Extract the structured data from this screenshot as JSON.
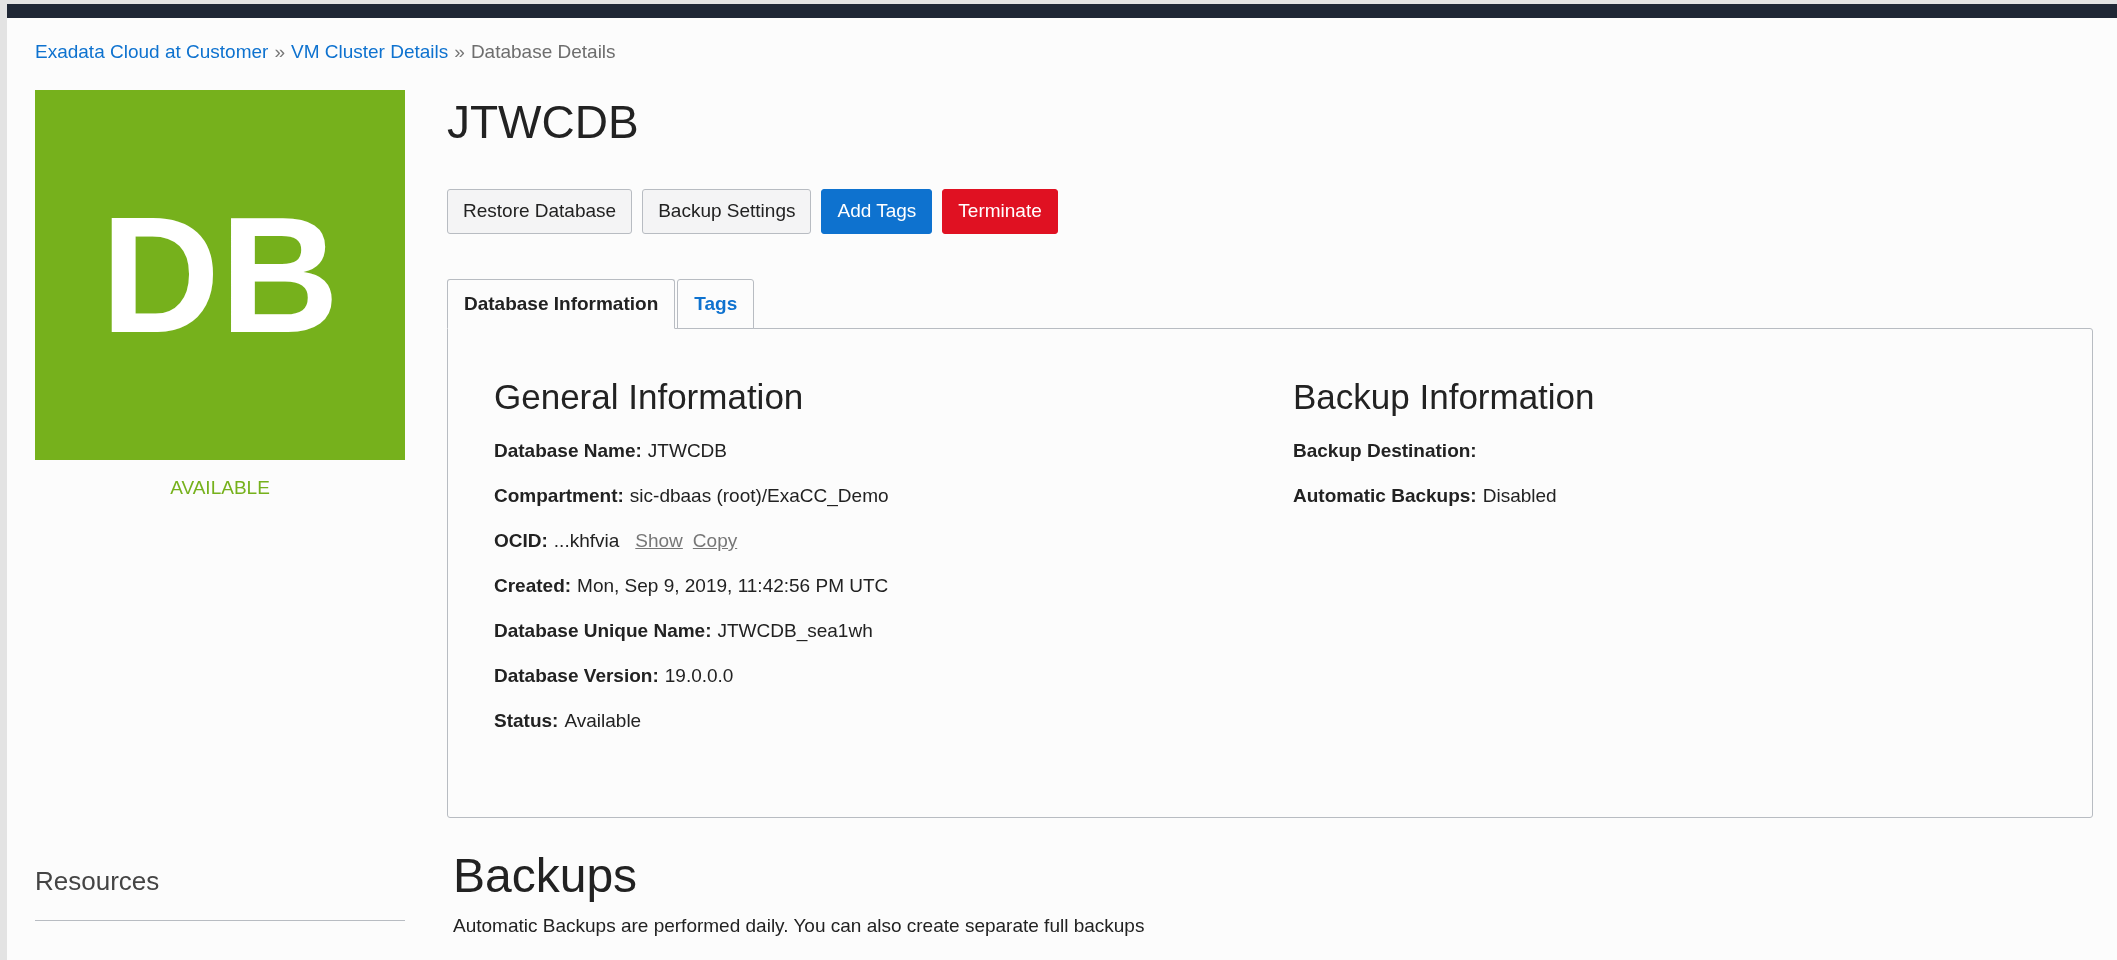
{
  "breadcrumb": [
    {
      "label": "Exadata Cloud at Customer",
      "kind": "link"
    },
    {
      "label": "»",
      "kind": "separator"
    },
    {
      "label": "VM Cluster Details",
      "kind": "link"
    },
    {
      "label": "»",
      "kind": "separator"
    },
    {
      "label": "Database Details",
      "kind": "current"
    }
  ],
  "tile": {
    "initials": "DB",
    "color": "#76b11c",
    "status": "AVAILABLE"
  },
  "title": "JTWCDB",
  "actions": [
    {
      "label": "Restore Database",
      "kind": "default"
    },
    {
      "label": "Backup Settings",
      "kind": "default"
    },
    {
      "label": "Add Tags",
      "kind": "primary"
    },
    {
      "label": "Terminate",
      "kind": "danger"
    }
  ],
  "tabs": [
    {
      "label": "Database Information",
      "selected": true
    },
    {
      "label": "Tags",
      "selected": false
    }
  ],
  "general": {
    "heading": "General Information",
    "fields": [
      {
        "label": "Database Name:",
        "value": "JTWCDB"
      },
      {
        "label": "Compartment:",
        "value": "sic-dbaas (root)/ExaCC_Demo"
      },
      {
        "label": "OCID:",
        "value": "...khfvia",
        "links": [
          "Show",
          "Copy"
        ]
      },
      {
        "label": "Created:",
        "value": "Mon, Sep 9, 2019, 11:42:56 PM UTC"
      },
      {
        "label": "Database Unique Name:",
        "value": "JTWCDB_sea1wh"
      },
      {
        "label": "Database Version:",
        "value": "19.0.0.0"
      },
      {
        "label": "Status:",
        "value": "Available"
      }
    ]
  },
  "backup": {
    "heading": "Backup Information",
    "fields": [
      {
        "label": "Backup Destination:"
      },
      {
        "label": "Automatic Backups:",
        "value": "Disabled"
      }
    ]
  },
  "resources": {
    "heading": "Resources"
  },
  "backups": {
    "heading": "Backups",
    "description": "Automatic Backups are performed daily. You can also create separate full backups"
  }
}
